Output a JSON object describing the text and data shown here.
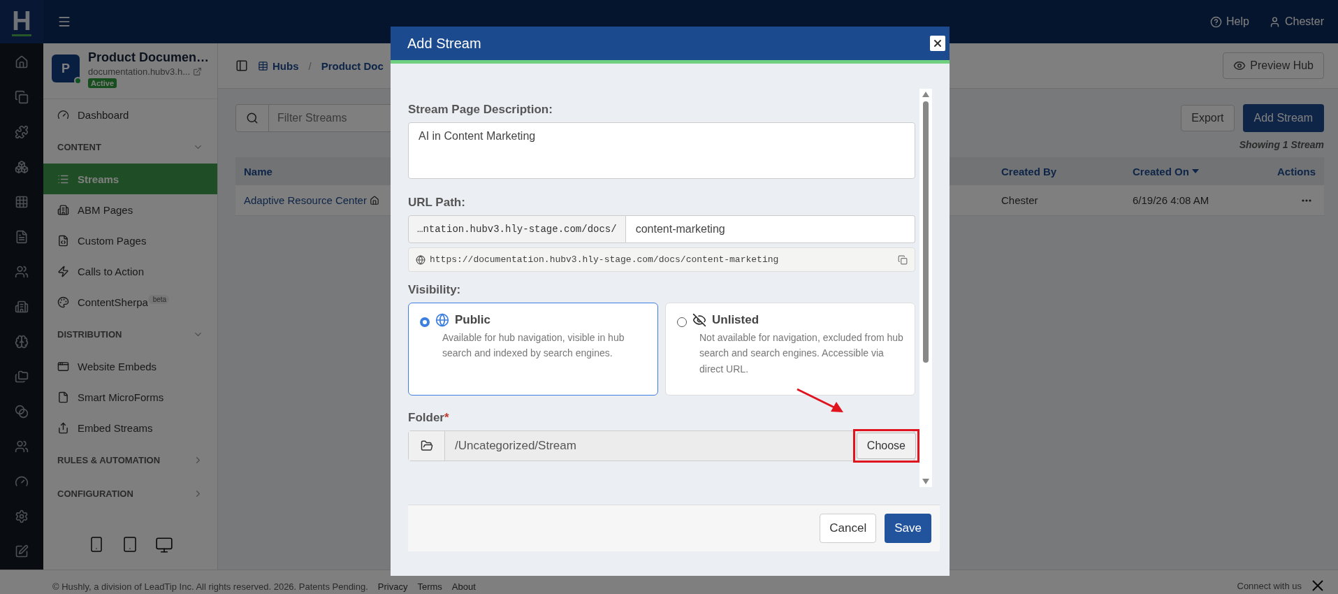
{
  "top_bar": {
    "logo": "H",
    "help": "Help",
    "user": "Chester"
  },
  "hub": {
    "initial": "P",
    "name": "Product Documen…",
    "domain": "documentation.hubv3.h...",
    "status": "Active"
  },
  "sidebar": {
    "top_items": [
      {
        "label": "Dashboard",
        "selected": false
      }
    ],
    "sections": [
      {
        "heading": "CONTENT",
        "expanded": true,
        "items": [
          {
            "label": "Streams",
            "selected": true
          },
          {
            "label": "ABM Pages",
            "selected": false
          },
          {
            "label": "Custom Pages",
            "selected": false
          },
          {
            "label": "Calls to Action",
            "selected": false
          },
          {
            "label": "ContentSherpa",
            "badge": "beta",
            "selected": false
          }
        ]
      },
      {
        "heading": "DISTRIBUTION",
        "expanded": true,
        "items": [
          {
            "label": "Website Embeds",
            "selected": false
          },
          {
            "label": "Smart MicroForms",
            "selected": false
          },
          {
            "label": "Embed Streams",
            "selected": false
          }
        ]
      },
      {
        "heading": "RULES & AUTOMATION",
        "expanded": false
      },
      {
        "heading": "CONFIGURATION",
        "expanded": false
      }
    ]
  },
  "breadcrumb": {
    "items": [
      "Hubs",
      "Product Doc"
    ],
    "separator": "/"
  },
  "preview_button": "Preview Hub",
  "filter": {
    "placeholder": "Filter Streams"
  },
  "export_button": "Export",
  "add_button": "Add Stream",
  "count": "Showing 1 Stream",
  "table": {
    "columns": [
      {
        "label": "Name",
        "sorted": false
      },
      {
        "label": "Created By",
        "sorted": false
      },
      {
        "label": "Created On",
        "sorted": true
      },
      {
        "label": "Actions",
        "sorted": false
      }
    ],
    "rows": [
      {
        "name": "Adaptive Resource Center",
        "created_by": "Chester",
        "created_on": "6/19/26 4:08 AM"
      }
    ]
  },
  "modal": {
    "title": "Add Stream",
    "description_label": "Stream Page Description:",
    "description": "AI in Content Marketing",
    "url_label": "URL Path:",
    "url_prefix": "…ntation.hubv3.hly-stage.com/docs/",
    "url_slug": "content-marketing",
    "url_preview": "https://documentation.hubv3.hly-stage.com/docs/content-marketing",
    "visibility_label": "Visibility:",
    "visibility": [
      {
        "kind": "public",
        "title": "Public",
        "text": "Available for hub navigation, visible in hub search and indexed by search engines.",
        "selected": true
      },
      {
        "kind": "unlisted",
        "title": "Unlisted",
        "text": "Not available for navigation, excluded from hub search and search engines. Accessible via direct URL.",
        "selected": false
      }
    ],
    "folder_label": "Folder",
    "required_mark": "*",
    "folder": "/Uncategorized/Stream",
    "choose_button": "Choose",
    "cancel_button": "Cancel",
    "save_button": "Save"
  },
  "footer": {
    "copyright": "© Hushly, a division of LeadTip Inc. All rights reserved. 2026. Patents Pending.",
    "links": [
      "Privacy",
      "Terms",
      "About"
    ],
    "connect": "Connect with us"
  }
}
